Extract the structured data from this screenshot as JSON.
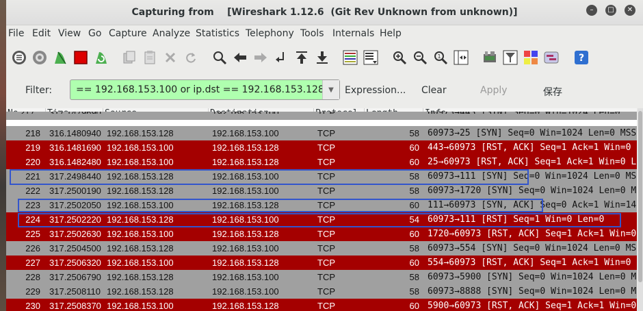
{
  "window": {
    "title": "Capturing from    [Wireshark 1.12.6  (Git Rev Unknown from unknown)]",
    "controls": [
      "minimize",
      "maximize",
      "close"
    ]
  },
  "menu": [
    "File",
    "Edit",
    "View",
    "Go",
    "Capture",
    "Analyze",
    "Statistics",
    "Telephony",
    "Tools",
    "Internals",
    "Help"
  ],
  "toolbar": {
    "icons": [
      "interfaces-icon",
      "options-icon",
      "start-capture-icon",
      "stop-capture-icon",
      "restart-capture-icon",
      "open-file-icon",
      "save-file-icon",
      "close-file-icon",
      "reload-icon",
      "find-icon",
      "back-icon",
      "forward-icon",
      "goto-packet-icon",
      "first-packet-icon",
      "last-packet-icon",
      "colorize-icon",
      "autoscroll-icon",
      "zoom-in-icon",
      "zoom-out-icon",
      "normal-size-icon",
      "resize-columns-icon",
      "capture-filters-icon",
      "display-filters-icon",
      "coloring-rules-icon",
      "preferences-icon",
      "help-icon"
    ]
  },
  "filter": {
    "label": "Filter:",
    "value": "== 192.168.153.100 or ip.dst == 192.168.153.128",
    "expression_label": "Expression...",
    "clear_label": "Clear",
    "apply_label": "Apply",
    "save_label": "保存",
    "valid_color": "#afffaf"
  },
  "packet_list": {
    "columns": [
      "No.",
      "Time",
      "Source",
      "Destination",
      "Protocol",
      "Length",
      "Info"
    ],
    "row_colors": {
      "gray": "#a0a0a0",
      "red": "#a40000"
    },
    "partial_top_row": {
      "no": "217",
      "time": "317.1479690",
      "dst": "192.168.153.100",
      "proto": "TCP",
      "info": "60973→443 [SYN] Seq=0 Win=1024 Len=0"
    },
    "rows": [
      {
        "no": "218",
        "time": "316.1480940",
        "src": "192.168.153.128",
        "dst": "192.168.153.100",
        "proto": "TCP",
        "len": "58",
        "info": "60973→25 [SYN] Seq=0 Win=1024 Len=0 MSS",
        "color": "gray"
      },
      {
        "no": "219",
        "time": "316.1481690",
        "src": "192.168.153.100",
        "dst": "192.168.153.128",
        "proto": "TCP",
        "len": "60",
        "info": "443→60973 [RST, ACK] Seq=1 Ack=1 Win=0",
        "color": "red"
      },
      {
        "no": "220",
        "time": "316.1482480",
        "src": "192.168.153.100",
        "dst": "192.168.153.128",
        "proto": "TCP",
        "len": "60",
        "info": "25→60973 [RST, ACK] Seq=1 Ack=1 Win=0 L",
        "color": "red"
      },
      {
        "no": "221",
        "time": "317.2498440",
        "src": "192.168.153.128",
        "dst": "192.168.153.100",
        "proto": "TCP",
        "len": "58",
        "info": "60973→111 [SYN] Seq=0 Win=1024 Len=0 MS",
        "color": "gray"
      },
      {
        "no": "222",
        "time": "317.2500190",
        "src": "192.168.153.128",
        "dst": "192.168.153.100",
        "proto": "TCP",
        "len": "58",
        "info": "60973→1720 [SYN] Seq=0 Win=1024 Len=0 M",
        "color": "gray"
      },
      {
        "no": "223",
        "time": "317.2502050",
        "src": "192.168.153.100",
        "dst": "192.168.153.128",
        "proto": "TCP",
        "len": "60",
        "info": "111→60973 [SYN, ACK] Seq=0 Ack=1 Win=14",
        "color": "gray"
      },
      {
        "no": "224",
        "time": "317.2502220",
        "src": "192.168.153.128",
        "dst": "192.168.153.100",
        "proto": "TCP",
        "len": "54",
        "info": "60973→111 [RST] Seq=1 Win=0 Len=0",
        "color": "red"
      },
      {
        "no": "225",
        "time": "317.2502630",
        "src": "192.168.153.100",
        "dst": "192.168.153.128",
        "proto": "TCP",
        "len": "60",
        "info": "1720→60973 [RST, ACK] Seq=1 Ack=1 Win=0",
        "color": "red"
      },
      {
        "no": "226",
        "time": "317.2504500",
        "src": "192.168.153.128",
        "dst": "192.168.153.100",
        "proto": "TCP",
        "len": "58",
        "info": "60973→554 [SYN] Seq=0 Win=1024 Len=0 MS",
        "color": "gray"
      },
      {
        "no": "227",
        "time": "317.2506320",
        "src": "192.168.153.100",
        "dst": "192.168.153.128",
        "proto": "TCP",
        "len": "60",
        "info": "554→60973 [RST, ACK] Seq=1 Ack=1 Win=0",
        "color": "red"
      },
      {
        "no": "228",
        "time": "317.2506790",
        "src": "192.168.153.128",
        "dst": "192.168.153.100",
        "proto": "TCP",
        "len": "58",
        "info": "60973→5900 [SYN] Seq=0 Win=1024 Len=0 M",
        "color": "gray"
      },
      {
        "no": "229",
        "time": "317.2508110",
        "src": "192.168.153.128",
        "dst": "192.168.153.100",
        "proto": "TCP",
        "len": "58",
        "info": "60973→8888 [SYN] Seq=0 Win=1024 Len=0 M",
        "color": "gray"
      },
      {
        "no": "230",
        "time": "317.2508370",
        "src": "192.168.153.100",
        "dst": "192.168.153.128",
        "proto": "TCP",
        "len": "60",
        "info": "5900→60973 [RST, ACK] Seq=1 Ack=1 Win=0",
        "color": "red"
      }
    ],
    "highlight_color": "#3355cc"
  }
}
